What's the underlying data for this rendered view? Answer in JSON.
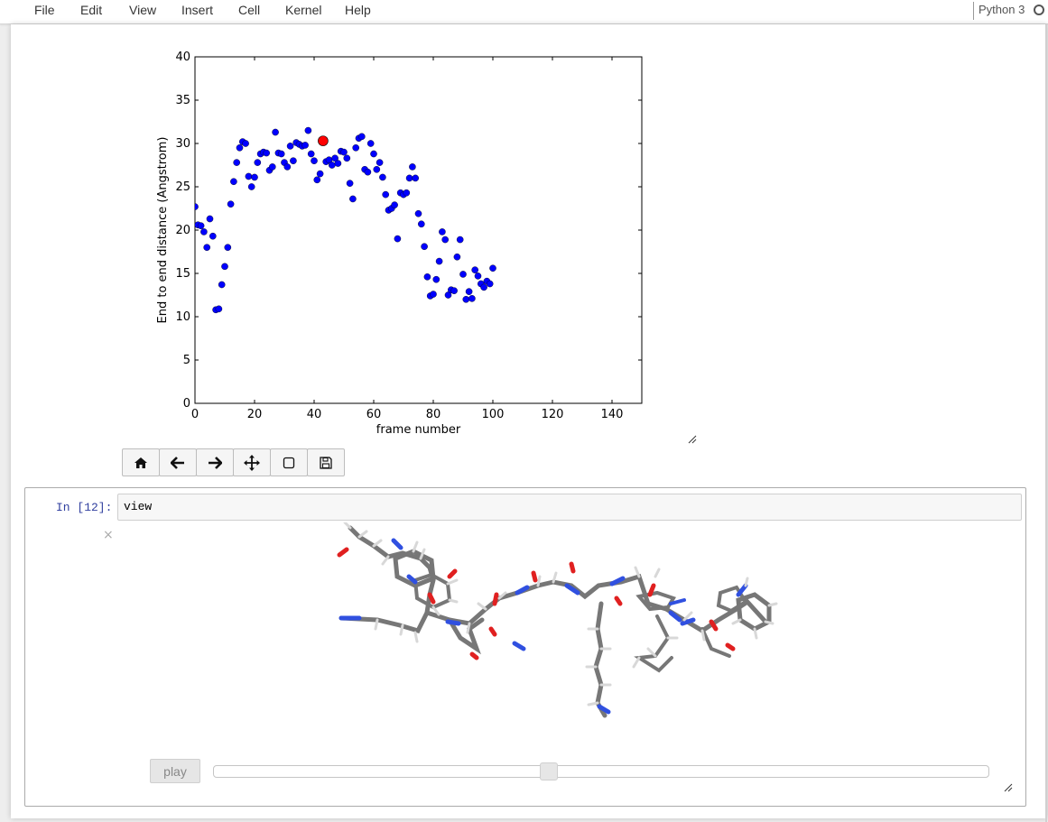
{
  "menubar": {
    "items": [
      "File",
      "Edit",
      "View",
      "Insert",
      "Cell",
      "Kernel",
      "Help"
    ],
    "kernel_name": "Python 3"
  },
  "figure_toolbar": {
    "buttons": [
      "home-icon",
      "back-arrow-icon",
      "forward-arrow-icon",
      "pan-move-icon",
      "zoom-rect-icon",
      "save-icon"
    ]
  },
  "chart_data": {
    "type": "scatter",
    "xlabel": "frame number",
    "ylabel": "End to end distance (Angstrom)",
    "xlim": [
      0,
      150
    ],
    "ylim": [
      0,
      40
    ],
    "xticks": [
      0,
      20,
      40,
      60,
      80,
      100,
      120,
      140
    ],
    "yticks": [
      0,
      5,
      10,
      15,
      20,
      25,
      30,
      35,
      40
    ],
    "grid": false,
    "series": [
      {
        "color": "#0000ff",
        "x": [
          0,
          1,
          2,
          3,
          4,
          5,
          6,
          7,
          8,
          9,
          10,
          11,
          12,
          13,
          14,
          15,
          16,
          17,
          18,
          19,
          20,
          21,
          22,
          23,
          24,
          25,
          26,
          27,
          28,
          29,
          30,
          31,
          32,
          33,
          34,
          35,
          36,
          37,
          38,
          39,
          40,
          41,
          42,
          43,
          44,
          45,
          46,
          47,
          48,
          49,
          50,
          51,
          52,
          53,
          54,
          55,
          56,
          57,
          58,
          59,
          60,
          61,
          62,
          63,
          64,
          65,
          66,
          67,
          68,
          69,
          70,
          71,
          72,
          73,
          74,
          75,
          76,
          77,
          78,
          79,
          80,
          81,
          82,
          83,
          84,
          85,
          86,
          87,
          88,
          89,
          90,
          91,
          92,
          93,
          94,
          95,
          96,
          97,
          98,
          99,
          100
        ],
        "y": [
          22.7,
          20.6,
          20.5,
          19.8,
          18.0,
          21.3,
          19.3,
          10.8,
          10.9,
          13.7,
          15.8,
          18.0,
          23.0,
          25.6,
          27.8,
          29.5,
          30.2,
          30.0,
          26.2,
          25.0,
          26.1,
          27.8,
          28.8,
          29.0,
          28.9,
          26.9,
          27.3,
          31.3,
          28.9,
          28.8,
          27.8,
          27.3,
          29.7,
          28.0,
          30.1,
          29.9,
          29.7,
          29.8,
          31.5,
          28.8,
          28.0,
          25.8,
          26.5,
          30.3,
          27.9,
          28.1,
          27.5,
          28.3,
          27.7,
          29.1,
          29.0,
          28.3,
          25.4,
          23.6,
          29.5,
          30.6,
          30.8,
          27.0,
          26.7,
          30.0,
          28.8,
          27.0,
          27.8,
          26.1,
          24.1,
          22.3,
          22.5,
          22.9,
          19.0,
          24.3,
          24.1,
          24.3,
          26.0,
          27.3,
          26.0,
          21.9,
          20.7,
          18.1,
          14.6,
          12.4,
          12.6,
          14.3,
          16.4,
          19.8,
          18.9,
          12.5,
          13.1,
          13.0,
          16.9,
          18.9,
          14.9,
          12.0,
          12.9,
          12.1,
          15.4,
          14.7,
          13.8,
          13.4,
          14.1,
          13.8,
          15.6
        ]
      }
    ],
    "highlight": {
      "x": 43,
      "y": 30.3,
      "color": "#ff0000"
    }
  },
  "cell": {
    "prompt": "In [12]:",
    "code": "view",
    "close_label": "×",
    "play_label": "play",
    "slider_fraction": 0.43
  }
}
